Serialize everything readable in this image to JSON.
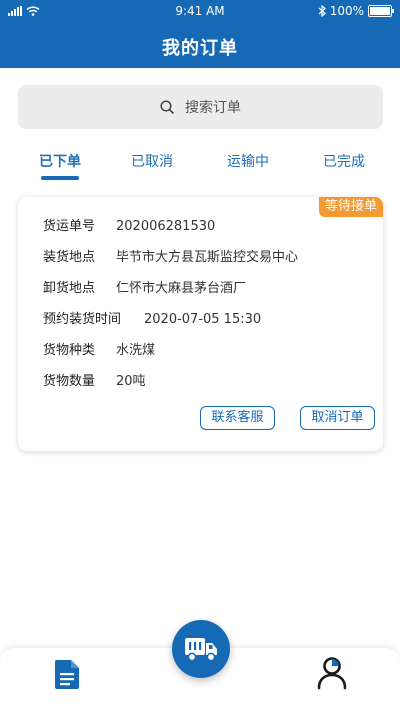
{
  "status_bar": {
    "time": "9:41 AM",
    "battery": "100%"
  },
  "header": {
    "title": "我的订单"
  },
  "search": {
    "placeholder": "搜索订单",
    "icon": "search-icon"
  },
  "tabs": [
    {
      "label": "已下单",
      "active": true
    },
    {
      "label": "已取消",
      "active": false
    },
    {
      "label": "运输中",
      "active": false
    },
    {
      "label": "已完成",
      "active": false
    }
  ],
  "order": {
    "status_badge": "等待接单",
    "fields": [
      {
        "label": "货运单号",
        "value": "202006281530"
      },
      {
        "label": "装货地点",
        "value": "毕节市大方县瓦斯监控交易中心"
      },
      {
        "label": "卸货地点",
        "value": "仁怀市大麻县茅台酒厂"
      },
      {
        "label": "预约装货时间",
        "value": "2020-07-05 15:30"
      },
      {
        "label": "货物种类",
        "value": "水洗煤"
      },
      {
        "label": "货物数量",
        "value": "20吨"
      }
    ],
    "actions": {
      "contact": "联系客服",
      "cancel": "取消订单"
    }
  },
  "bottom_nav": {
    "left_icon": "document-icon",
    "center_icon": "truck-icon",
    "right_icon": "user-icon"
  },
  "colors": {
    "primary": "#1669b5",
    "badge": "#f39a32"
  }
}
